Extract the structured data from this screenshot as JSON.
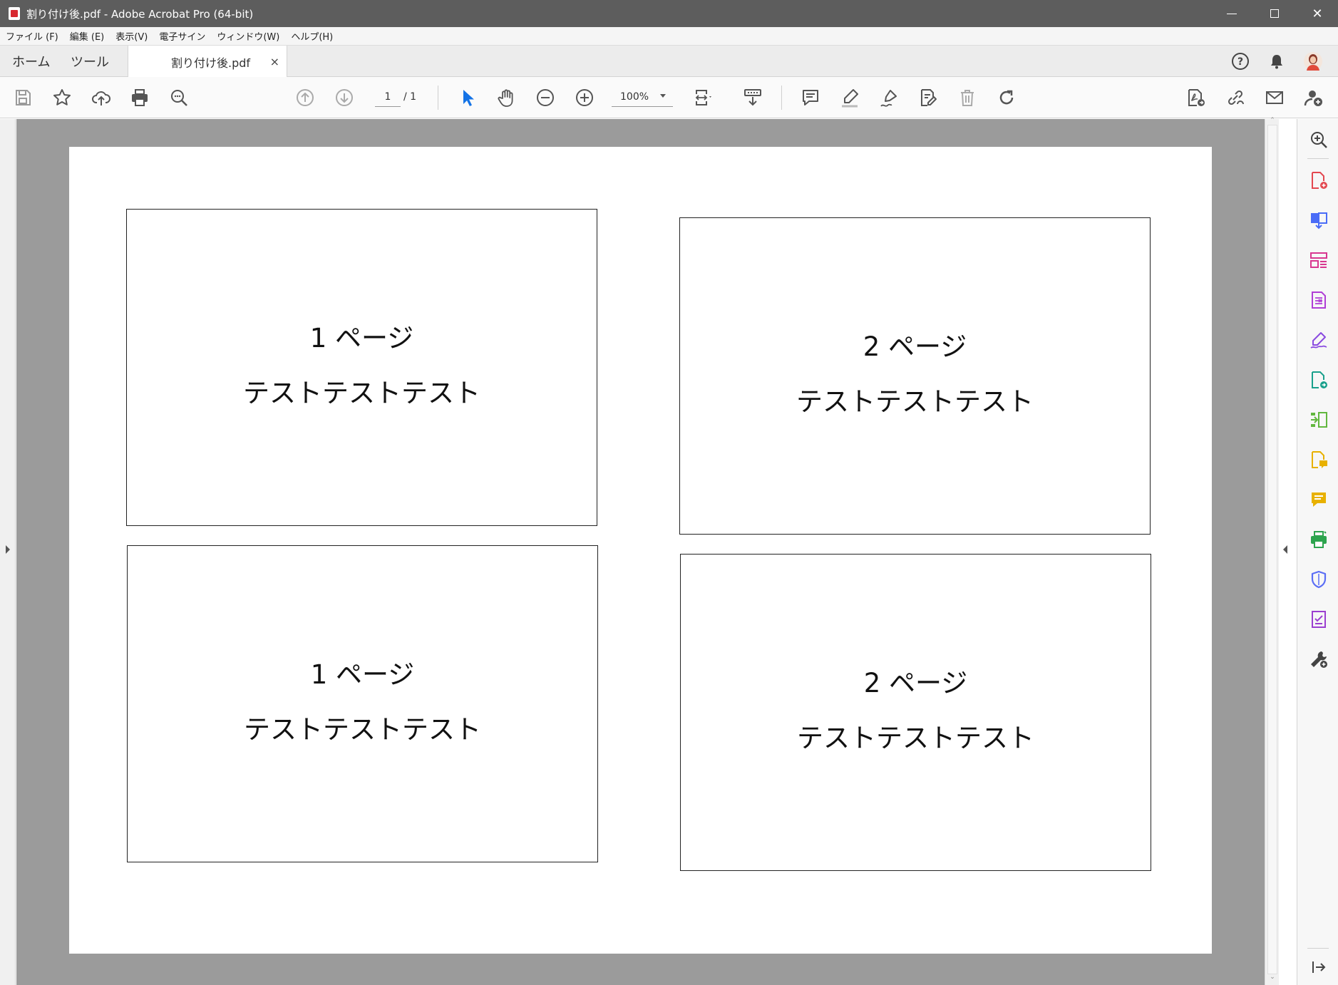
{
  "window": {
    "title": "割り付け後.pdf - Adobe Acrobat Pro (64-bit)",
    "minimize": "—",
    "maximize": "☐",
    "close": "✕"
  },
  "menu": [
    "ファイル (F)",
    "編集 (E)",
    "表示(V)",
    "電子サイン",
    "ウィンドウ(W)",
    "ヘルプ(H)"
  ],
  "tabs": {
    "home": "ホーム",
    "tools": "ツール",
    "document": "割り付け後.pdf",
    "close": "×"
  },
  "toolbar": {
    "page_current": "1",
    "page_total": "/ 1",
    "zoom": "100%"
  },
  "document": {
    "cards": [
      {
        "page_label": "1 ページ",
        "text": "テストテストテスト"
      },
      {
        "page_label": "2 ページ",
        "text": "テストテストテスト"
      },
      {
        "page_label": "1 ページ",
        "text": "テストテストテスト"
      },
      {
        "page_label": "2 ページ",
        "text": "テストテストテスト"
      }
    ]
  },
  "icons": {
    "save": "save-icon",
    "bookmark": "star-icon",
    "upload": "cloud-upload-icon",
    "print": "print-icon",
    "search": "magnify-icon",
    "prev_page": "arrow-up-circle-icon",
    "next_page": "arrow-down-circle-icon",
    "select": "pointer-icon",
    "hand": "hand-icon",
    "zoom_out": "minus-circle-icon",
    "zoom_in": "plus-circle-icon",
    "fit": "fit-page-icon",
    "scroll": "scroll-mode-icon",
    "comment": "comment-icon",
    "highlight": "highlighter-icon",
    "draw": "pen-icon",
    "edit": "edit-doc-icon",
    "delete": "trash-icon",
    "rotate": "rotate-icon",
    "export": "export-pdf-icon",
    "share_link": "share-link-icon",
    "email": "mail-icon",
    "add_user": "add-user-icon",
    "help": "help-icon",
    "bell": "bell-icon",
    "avatar": "avatar-icon"
  },
  "colors": {
    "titlebar": "#5d5d5d",
    "doc_bg": "#9b9b9b",
    "select_blue": "#1473e6",
    "create_red": "#e34850",
    "combine_blue": "#4a6cf7",
    "organize_pink": "#d83790",
    "export_purple": "#b03fd6",
    "sign_purple": "#8a4be0",
    "send_teal": "#1aa08c",
    "compress_green": "#62b73f",
    "comment_yellow": "#e8b100",
    "print_green": "#2da44e",
    "protect_blue": "#5b6ef5",
    "review_purple": "#9b3fd0"
  }
}
